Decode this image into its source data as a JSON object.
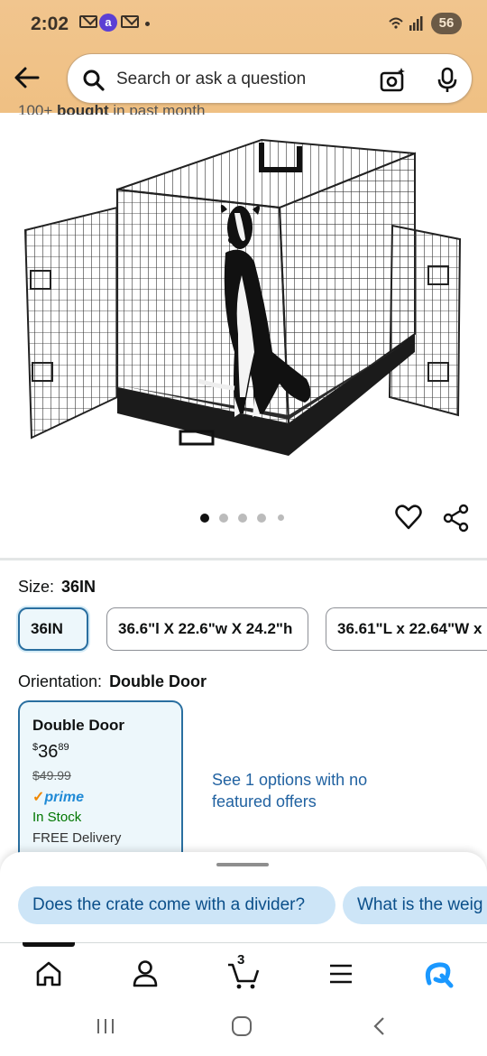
{
  "status_bar": {
    "time": "2:02",
    "battery": "56"
  },
  "search": {
    "placeholder": "Search or ask a question"
  },
  "peek": {
    "count": "100+",
    "bought": "bought",
    "rest": "in past month"
  },
  "carousel": {
    "total": 5,
    "active_index": 0
  },
  "size": {
    "label": "Size:",
    "value": "36IN"
  },
  "size_options": [
    {
      "label": "36IN",
      "selected": true
    },
    {
      "label": "36.6\"l X 22.6\"w X 24.2\"h",
      "selected": false
    },
    {
      "label": "36.61\"L x 22.64\"W x",
      "selected": false
    }
  ],
  "orientation": {
    "label": "Orientation:",
    "value": "Double Door"
  },
  "option_card": {
    "title": "Double Door",
    "currency": "$",
    "price_whole": "36",
    "price_fraction": "89",
    "list_price": "$49.99",
    "prime_label": "prime",
    "stock": "In Stock",
    "delivery": "FREE Delivery"
  },
  "see_options": "See 1 options with no featured offers",
  "questions": [
    "Does the crate come with a divider?",
    "What is the weig"
  ],
  "nav": {
    "cart_count": "3"
  },
  "colors": {
    "header_bg": "#efc083",
    "link": "#2162a1",
    "selected_border": "#2a6fa0",
    "prime_blue": "#1f8ad6",
    "in_stock": "#007600"
  }
}
